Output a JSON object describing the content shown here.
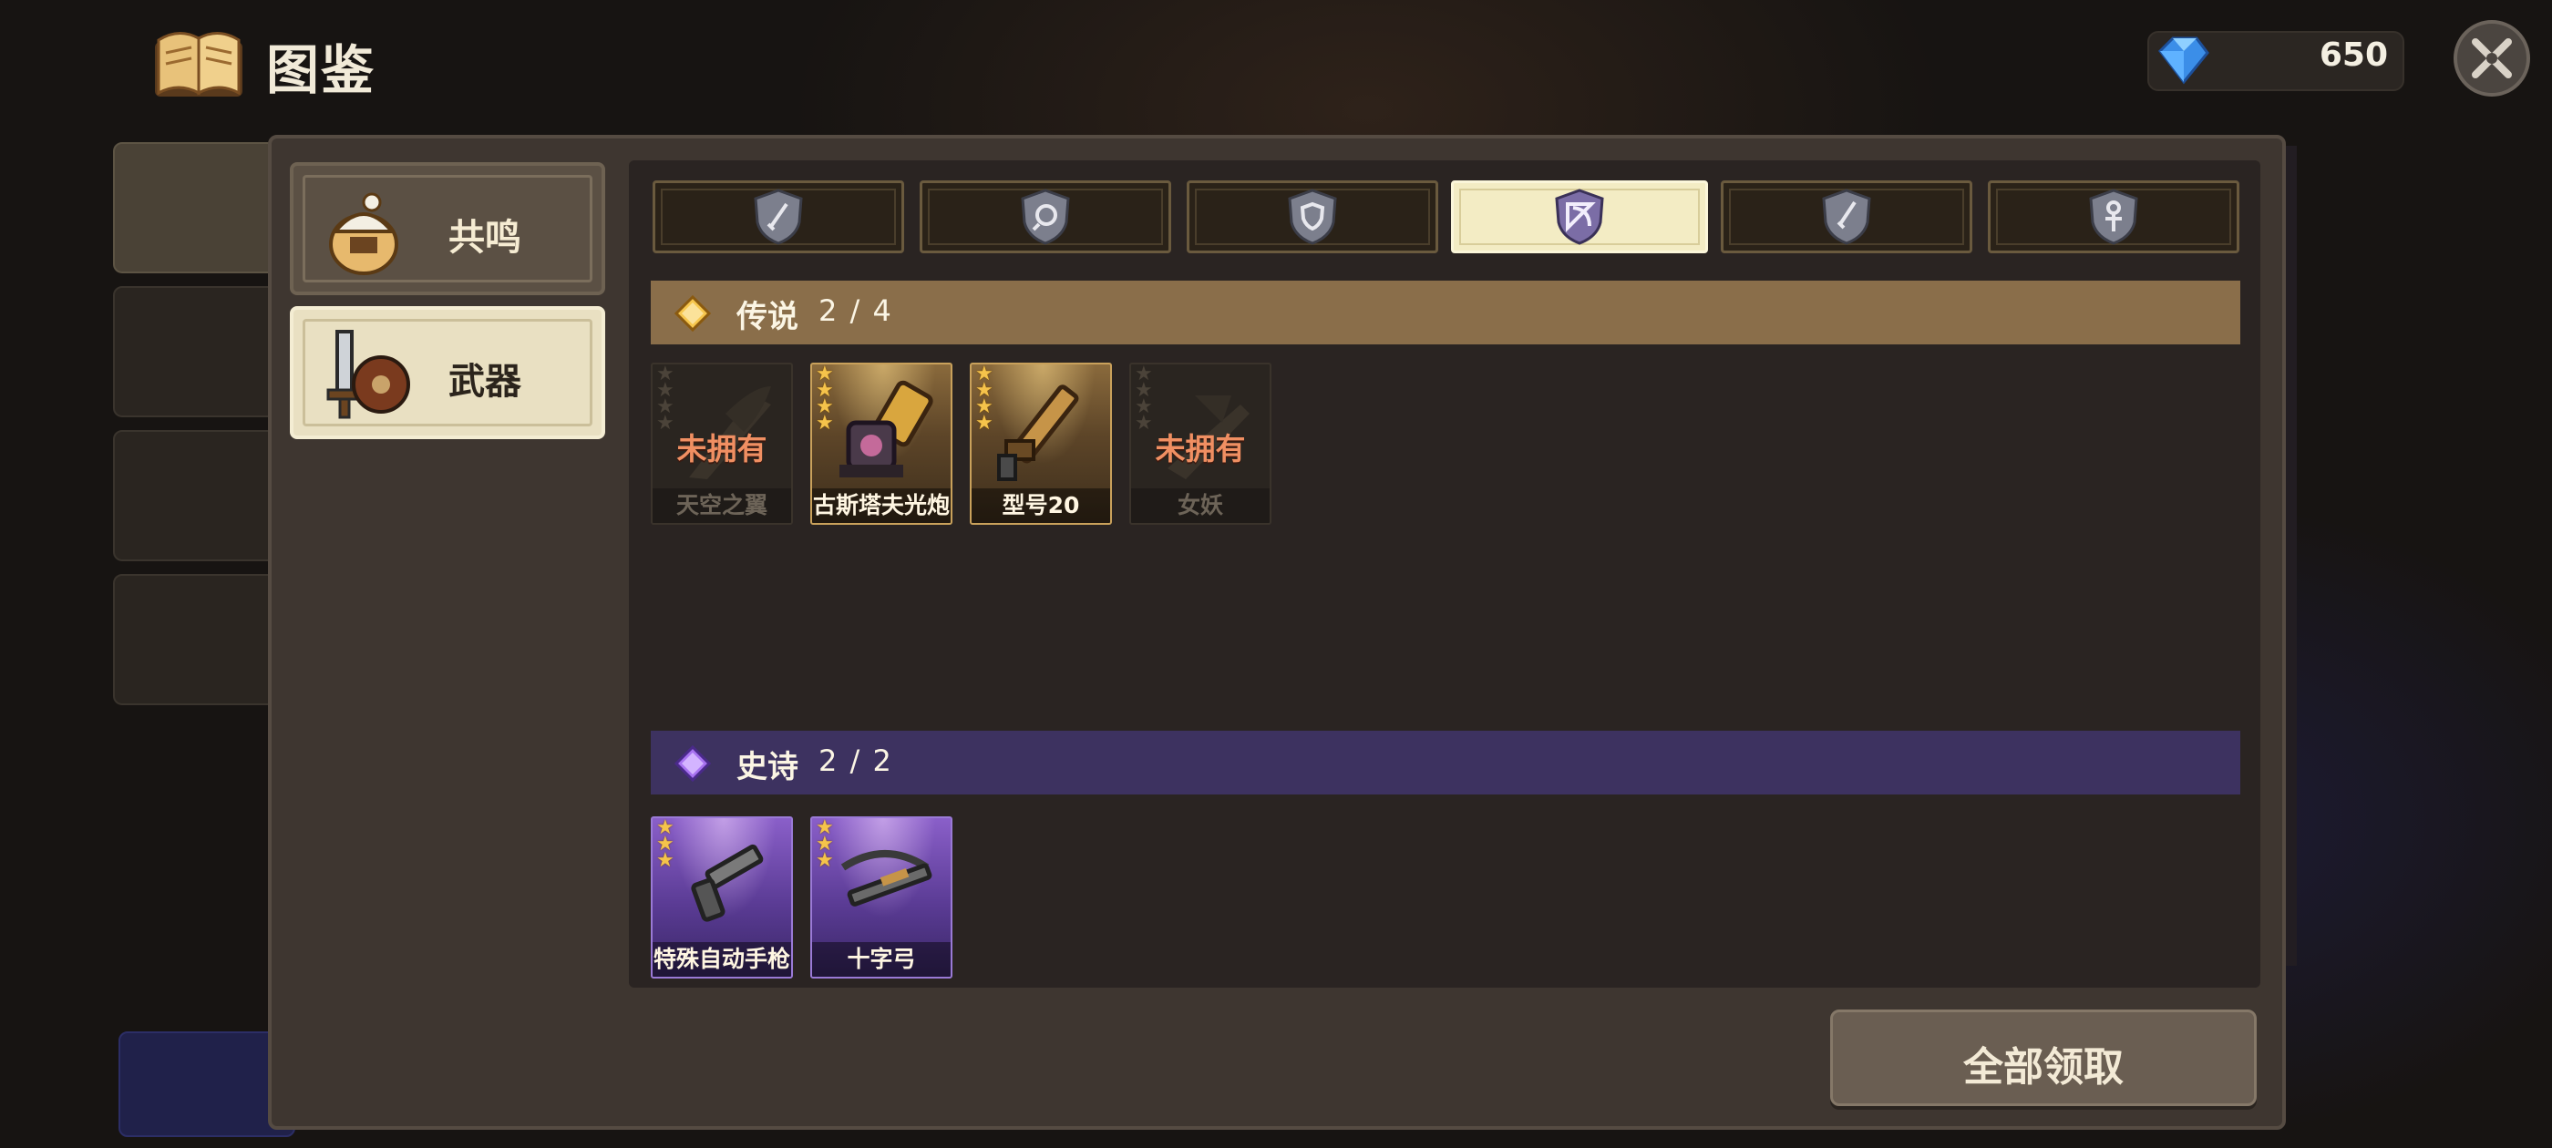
{
  "header": {
    "title": "图鉴",
    "book_icon": "book-icon",
    "gem_icon": "blue-gem-icon",
    "gem_count": "650",
    "close_icon": "close-x-icon"
  },
  "sidebar": {
    "items": [
      {
        "label": "共鸣",
        "icon": "helmet-resonance-icon",
        "selected": false
      },
      {
        "label": "武器",
        "icon": "sword-shield-icon",
        "selected": true
      }
    ]
  },
  "category_tabs": [
    {
      "icon": "sword-shield-badge-icon",
      "selected": false
    },
    {
      "icon": "orb-shield-badge-icon",
      "selected": false
    },
    {
      "icon": "shield-shield-badge-icon",
      "selected": false
    },
    {
      "icon": "bow-shield-badge-icon",
      "selected": true
    },
    {
      "icon": "dagger-shield-badge-icon",
      "selected": false
    },
    {
      "icon": "staff-shield-badge-icon",
      "selected": false
    }
  ],
  "sections": [
    {
      "name": "传说",
      "count": "2 / 4",
      "color": "#8a6e4a",
      "items": [
        {
          "name": "天空之翼",
          "stars": 4,
          "owned": false,
          "locked_label": "未拥有"
        },
        {
          "name": "古斯塔夫光炮",
          "stars": 4,
          "owned": true
        },
        {
          "name": "型号20",
          "stars": 4,
          "owned": true
        },
        {
          "name": "女妖",
          "stars": 4,
          "owned": false,
          "locked_label": "未拥有"
        }
      ]
    },
    {
      "name": "史诗",
      "count": "2 / 2",
      "color": "#3d3260",
      "items": [
        {
          "name": "特殊自动手枪",
          "stars": 3,
          "owned": true
        },
        {
          "name": "十字弓",
          "stars": 3,
          "owned": true
        }
      ]
    }
  ],
  "claim_all_label": "全部领取",
  "colors": {
    "legendary_bar": "#8a6e4a",
    "epic_bar": "#3d3260",
    "locked_text": "#f08f62",
    "star": "#f5c34b"
  }
}
